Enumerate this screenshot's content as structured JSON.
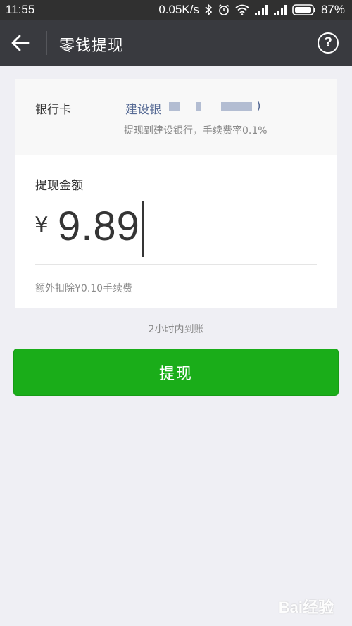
{
  "status_bar": {
    "time": "11:55",
    "network_speed": "0.05K/s",
    "battery": "87%",
    "icons": [
      "bluetooth-icon",
      "alarm-icon",
      "wifi-icon",
      "signal-icon",
      "signal-icon",
      "battery-icon"
    ]
  },
  "header": {
    "title": "零钱提现",
    "back_icon": "arrow-left-icon",
    "help_icon": "question-mark-icon",
    "help_label": "?"
  },
  "bank_card": {
    "label": "银行卡",
    "bank_name": "建设银",
    "bank_name_end": ")",
    "description": "提现到建设银行，手续费率0.1%"
  },
  "amount": {
    "label": "提现金额",
    "currency_symbol": "¥",
    "value": "9.89",
    "fee_note": "额外扣除¥0.10手续费"
  },
  "arrival_note": "2小时内到账",
  "withdraw_button_label": "提现",
  "watermark": "Bai经验",
  "colors": {
    "title_bar": "#393a3f",
    "status_bar": "#303030",
    "primary_green": "#1aad19",
    "link_blue": "#576b95",
    "background": "#efeff4"
  }
}
